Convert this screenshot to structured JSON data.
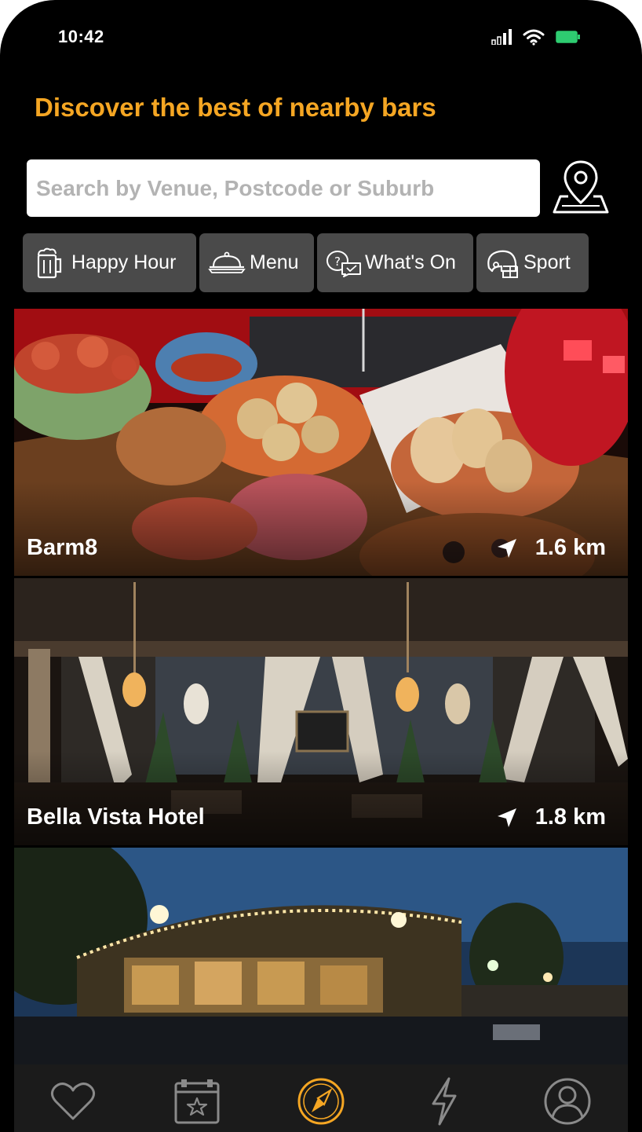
{
  "status_bar": {
    "time": "10:42",
    "icons": [
      "signal-icon",
      "wifi-icon",
      "battery-icon"
    ],
    "battery_color": "#2ecc71"
  },
  "header": {
    "title": "Discover the best of nearby bars"
  },
  "search": {
    "value": "",
    "placeholder": "Search by Venue, Postcode or Suburb",
    "map_button_icon": "map-pin-icon"
  },
  "filters": [
    {
      "label": "Happy Hour",
      "icon": "beer-mug-icon"
    },
    {
      "label": "Menu",
      "icon": "food-cloche-icon"
    },
    {
      "label": "What's On",
      "icon": "chat-bubbles-icon"
    },
    {
      "label": "Sport",
      "icon": "football-helmet-icon"
    }
  ],
  "venues": [
    {
      "name": "Barm8",
      "distance": "1.6 km"
    },
    {
      "name": "Bella Vista Hotel",
      "distance": "1.8 km"
    },
    {
      "name": "",
      "distance": ""
    }
  ],
  "tab_bar": {
    "tabs": [
      {
        "icon": "heart-icon",
        "active": false
      },
      {
        "icon": "calendar-star-icon",
        "active": false
      },
      {
        "icon": "compass-icon",
        "active": true
      },
      {
        "icon": "lightning-icon",
        "active": false
      },
      {
        "icon": "profile-icon",
        "active": false
      }
    ],
    "active_color": "#f5a623",
    "inactive_color": "#8a8a8a"
  },
  "colors": {
    "accent": "#f5a623",
    "background": "#000000",
    "chip": "#4a4a4a"
  }
}
